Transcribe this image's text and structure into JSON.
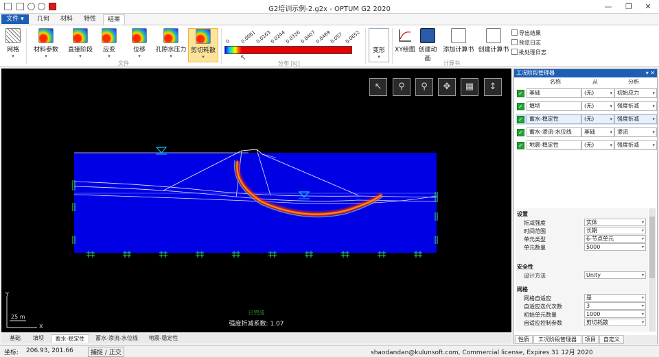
{
  "window": {
    "title": "G2培训示例-2.g2x - OPTUM G2 2020"
  },
  "ribbon_tabs": {
    "file": "文件 ▾",
    "tabs": [
      "几何",
      "材料",
      "特性",
      "结果"
    ],
    "active": 3
  },
  "ribbon": {
    "buttons": [
      "网格",
      "材料参数",
      "直接阶段",
      "应变",
      "位移",
      "孔隙水压力",
      "剪切耗散"
    ],
    "group_model": "文件",
    "group_distribution": "分布 [kJ]",
    "colorbar_ticks": [
      "0",
      "0.0081",
      "0.0163",
      "0.0244",
      "0.0326",
      "0.0407",
      "0.0489",
      "0.057",
      "0.0652"
    ],
    "deform_button": "变形",
    "tools": [
      "XY绘图",
      "创建动画",
      "添加计算书",
      "创建计算书"
    ],
    "group_report": "计算书",
    "small_cmds": [
      "导出结果",
      "预览日志",
      "批处理日志"
    ]
  },
  "viewport": {
    "status_text": "已完成",
    "fos_text": "强度折减系数: 1.07",
    "scale_label": "25 m",
    "axis_x": "X",
    "axis_y": "Y",
    "tools": [
      "select-arrow",
      "zoom",
      "zoom-fit",
      "pan",
      "grid",
      "dimension"
    ]
  },
  "stage_manager": {
    "title": "工况阶段管理器",
    "title_controls": "▾ ✕",
    "columns": [
      "名称",
      "从",
      "分析"
    ],
    "rows": [
      {
        "name": "基础",
        "from": "(无)",
        "analysis": "初始应力"
      },
      {
        "name": "填坝",
        "from": "(无)",
        "analysis": "强度折减"
      },
      {
        "name": "蓄水-稳定性",
        "from": "(无)",
        "analysis": "强度折减"
      },
      {
        "name": "蓄水-渗流-水位线",
        "from": "基础",
        "analysis": "渗流"
      },
      {
        "name": "地震-稳定性",
        "from": "(无)",
        "analysis": "强度折减"
      }
    ],
    "selected_row": 2
  },
  "settings": {
    "section_settings": "设置",
    "settings_rows": [
      {
        "label": "折减强度",
        "value": "实体"
      },
      {
        "label": "时间范围",
        "value": "长期"
      },
      {
        "label": "单元类型",
        "value": "6-节点单元"
      },
      {
        "label": "单元数量",
        "value": "5000"
      }
    ],
    "section_safety": "安全性",
    "safety_rows": [
      {
        "label": "设计方法",
        "value": "Unity"
      }
    ],
    "section_mesh": "网格",
    "mesh_rows": [
      {
        "label": "网格自适应",
        "value": "是"
      },
      {
        "label": "自适应迭代次数",
        "value": "3"
      },
      {
        "label": "初始单元数量",
        "value": "1000"
      },
      {
        "label": "自适应控制参数",
        "value": "剪切耗散"
      }
    ]
  },
  "panel_tabs": [
    "性质",
    "工况阶段管理器",
    "项目",
    "自定义"
  ],
  "bottom_tabs": [
    "基础",
    "填坝",
    "蓄水-稳定性",
    "蓄水-渗流-水位线",
    "地震-稳定性"
  ],
  "status": {
    "coord_label": "坐标:",
    "coords": "206.93, 201.66",
    "mode": "捕捉 / 正交",
    "license": "shaodandan@kulunsoft.com, Commercial license, Expires 31 12月 2020"
  }
}
